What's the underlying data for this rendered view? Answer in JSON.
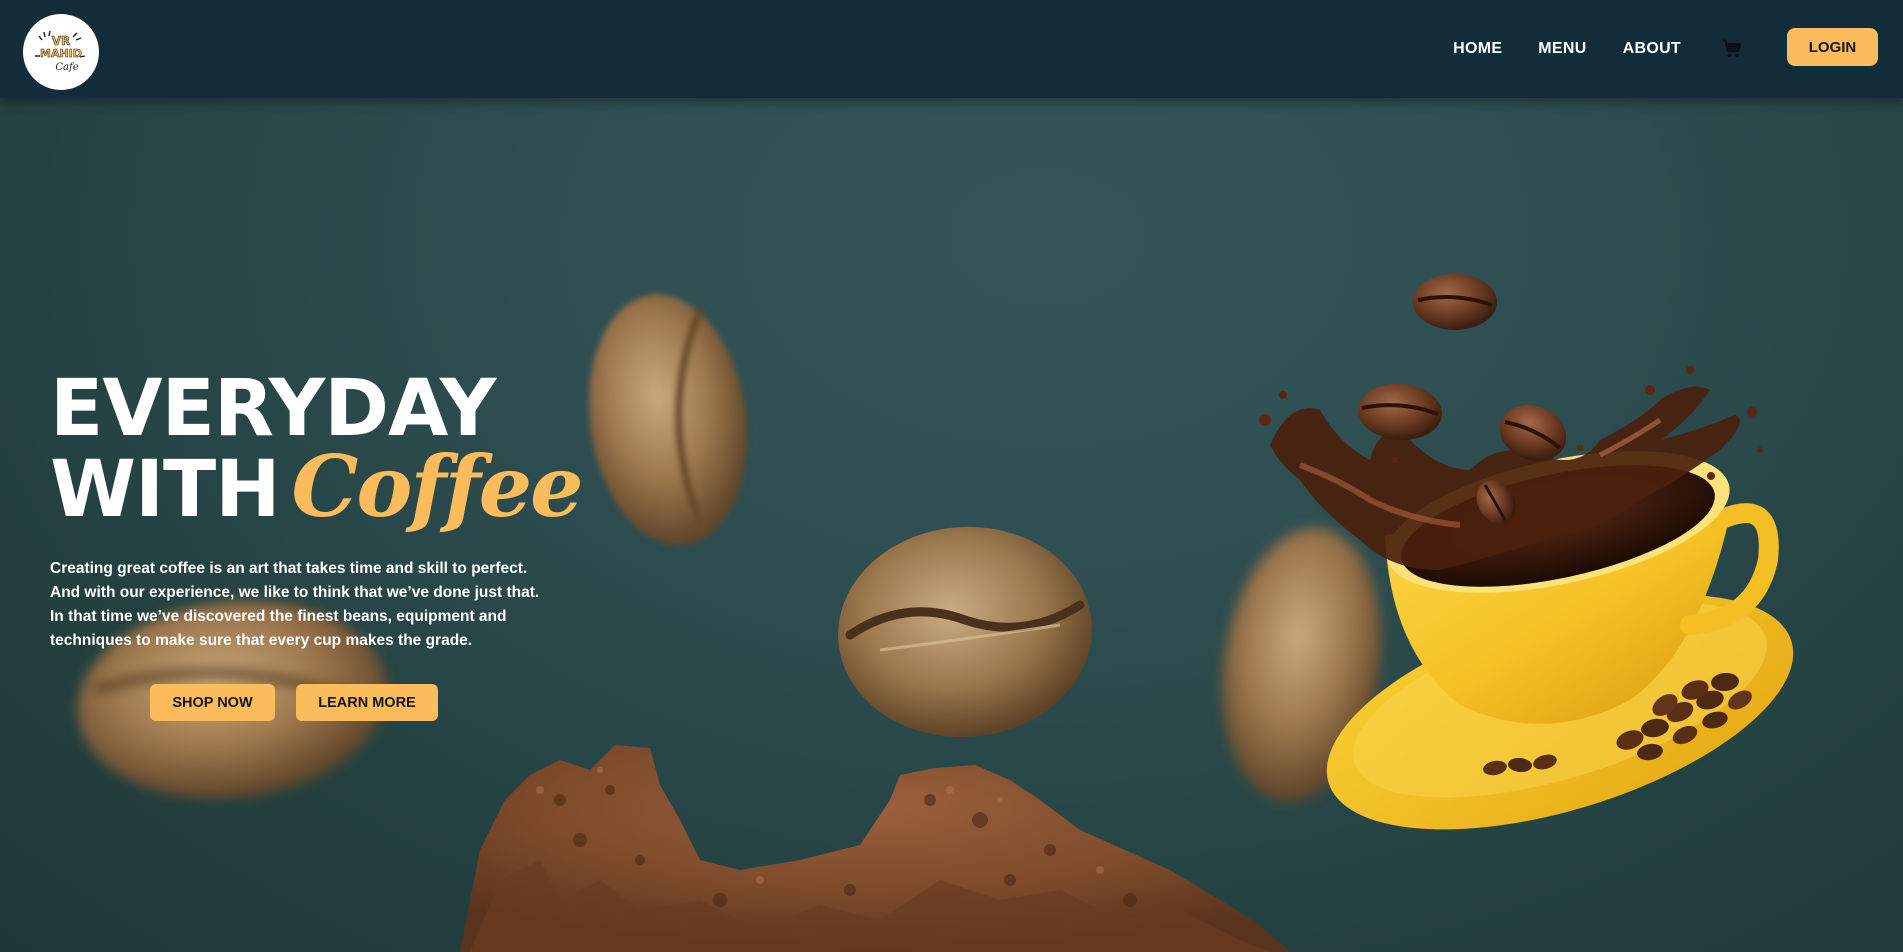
{
  "navbar": {
    "logo_text_top": "VR",
    "logo_text_mid": "MAHID",
    "logo_text_bottom": "Cafe",
    "links": [
      "HOME",
      "MENU",
      "ABOUT"
    ],
    "cart_icon": "cart-icon",
    "login_label": "LOGIN"
  },
  "hero": {
    "title_line1": "EVERYDAY",
    "title_line2_word": "WITH",
    "title_highlight": "Coffee",
    "description": "Creating great coffee is an art that takes time and skill to perfect. And with our experience, we like to think that we’ve done just that. In that time we’ve discovered the finest beans, equipment and techniques to make sure that every cup makes the grade.",
    "shop_label": "SHOP NOW",
    "learn_label": "LEARN MORE"
  },
  "colors": {
    "navbar_bg": "#132c39",
    "background": "#2e4e52",
    "accent": "#fdbc5c",
    "cup": "#f5c22b",
    "text": "#ffffff"
  }
}
